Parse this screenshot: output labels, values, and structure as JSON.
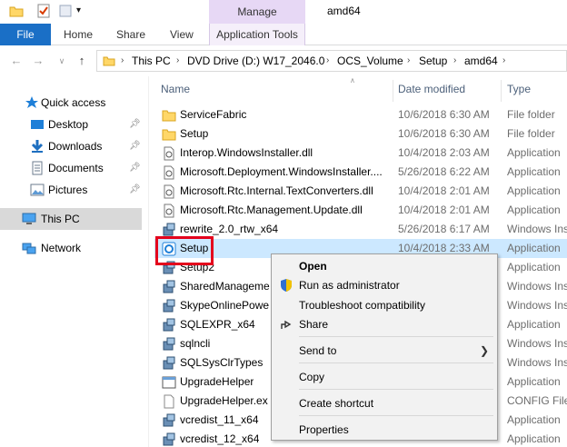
{
  "titlebar": {
    "manage_label": "Manage",
    "window_title": "amd64",
    "quick_access_icons": [
      "folder-icon",
      "properties-check-icon",
      "new-folder-icon",
      "dropdown-arrow-icon"
    ]
  },
  "ribbon": {
    "tabs": [
      "File",
      "Home",
      "Share",
      "View",
      "Application Tools"
    ]
  },
  "address": {
    "breadcrumbs": [
      "This PC",
      "DVD Drive (D:) W17_2046.0",
      "OCS_Volume",
      "Setup",
      "amd64"
    ]
  },
  "nav": {
    "quick_access": "Quick access",
    "items": [
      {
        "label": "Desktop",
        "icon": "desktop-icon",
        "pinned": true
      },
      {
        "label": "Downloads",
        "icon": "downloads-icon",
        "pinned": true
      },
      {
        "label": "Documents",
        "icon": "documents-icon",
        "pinned": true
      },
      {
        "label": "Pictures",
        "icon": "pictures-icon",
        "pinned": true
      }
    ],
    "this_pc": "This PC",
    "network": "Network"
  },
  "columns": {
    "name": "Name",
    "date": "Date modified",
    "type": "Type"
  },
  "files": [
    {
      "name": "ServiceFabric",
      "date": "10/6/2018 6:30 AM",
      "type": "File folder",
      "icon": "folder-icon"
    },
    {
      "name": "Setup",
      "date": "10/6/2018 6:30 AM",
      "type": "File folder",
      "icon": "folder-icon"
    },
    {
      "name": "Interop.WindowsInstaller.dll",
      "date": "10/4/2018 2:03 AM",
      "type": "Application",
      "icon": "dll-icon"
    },
    {
      "name": "Microsoft.Deployment.WindowsInstaller....",
      "date": "5/26/2018 6:22 AM",
      "type": "Application",
      "icon": "dll-icon"
    },
    {
      "name": "Microsoft.Rtc.Internal.TextConverters.dll",
      "date": "10/4/2018 2:01 AM",
      "type": "Application",
      "icon": "dll-icon"
    },
    {
      "name": "Microsoft.Rtc.Management.Update.dll",
      "date": "10/4/2018 2:01 AM",
      "type": "Application",
      "icon": "dll-icon"
    },
    {
      "name": "rewrite_2.0_rtw_x64",
      "date": "5/26/2018 6:17 AM",
      "type": "Windows Ins",
      "icon": "installer-icon"
    },
    {
      "name": "Setup",
      "date": "10/4/2018 2:33 AM",
      "type": "Application",
      "icon": "setup-app-icon"
    },
    {
      "name": "Setup2",
      "date": "",
      "type": "Application",
      "icon": "installer-icon"
    },
    {
      "name": "SharedManageme",
      "date": "",
      "type": "Windows Ins",
      "icon": "installer-icon"
    },
    {
      "name": "SkypeOnlinePowe",
      "date": "",
      "type": "Windows Ins",
      "icon": "installer-icon"
    },
    {
      "name": "SQLEXPR_x64",
      "date": "",
      "type": "Application",
      "icon": "installer-icon"
    },
    {
      "name": "sqlncli",
      "date": "",
      "type": "Windows Ins",
      "icon": "installer-icon"
    },
    {
      "name": "SQLSysClrTypes",
      "date": "",
      "type": "Windows Ins",
      "icon": "installer-icon"
    },
    {
      "name": "UpgradeHelper",
      "date": "",
      "type": "Application",
      "icon": "app-window-icon"
    },
    {
      "name": "UpgradeHelper.ex",
      "date": "",
      "type": "CONFIG File",
      "icon": "config-file-icon"
    },
    {
      "name": "vcredist_11_x64",
      "date": "",
      "type": "Application",
      "icon": "installer-icon"
    },
    {
      "name": "vcredist_12_x64",
      "date": "",
      "type": "Application",
      "icon": "installer-icon"
    }
  ],
  "context_menu": {
    "open": "Open",
    "run_as_admin": "Run as administrator",
    "troubleshoot": "Troubleshoot compatibility",
    "share": "Share",
    "send_to": "Send to",
    "copy": "Copy",
    "create_shortcut": "Create shortcut",
    "properties": "Properties"
  },
  "colors": {
    "file_tab": "#1a6fc6",
    "manage_tab": "#e7d8f5",
    "selection": "#cce8ff",
    "highlight_box": "#e4001c"
  }
}
